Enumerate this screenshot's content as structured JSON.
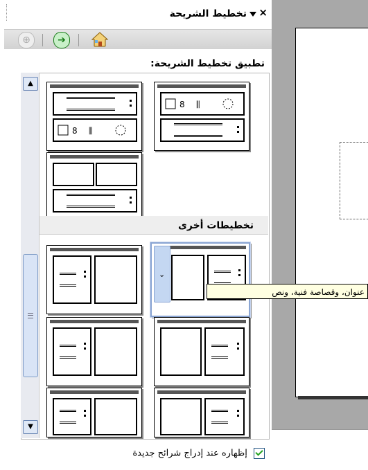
{
  "task_pane": {
    "title": "تخطيط الشريحة",
    "close_symbol": "×",
    "section_label": "تطبيق تخطيط الشريحة:",
    "other_layouts_label": "تخطيطات أخرى",
    "tooltip": "عنوان، وقصاصة فنية، ونص",
    "show_on_insert_label": "إظهاره عند إدراج شرائح جديدة",
    "show_on_insert_checked": true
  },
  "nav": {
    "back_icon": "back-arrow-icon",
    "forward_icon": "forward-arrow-icon",
    "home_icon": "home-icon"
  },
  "layouts": [
    {
      "group": "content",
      "name": "title-content-over-text"
    },
    {
      "group": "content",
      "name": "title-text-over-content"
    },
    {
      "group": "content",
      "name": "title-two-content-over-text"
    },
    {
      "group": "other",
      "name": "title-text-clipart",
      "selected": true
    },
    {
      "group": "other",
      "name": "title-clipart-text"
    },
    {
      "group": "other",
      "name": "title-text-chart"
    },
    {
      "group": "other",
      "name": "title-chart-text"
    },
    {
      "group": "other",
      "name": "title-text-media"
    },
    {
      "group": "other",
      "name": "title-media-text"
    }
  ],
  "colors": {
    "selection": "#8aa5d3",
    "checkmark": "#21a121"
  }
}
